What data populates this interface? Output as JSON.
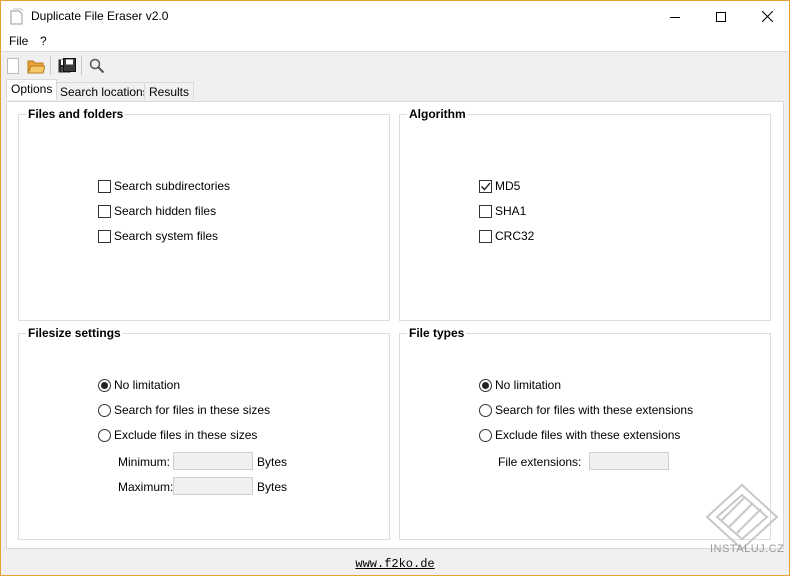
{
  "window": {
    "title": "Duplicate File Eraser v2.0",
    "border_color": "#e8a033"
  },
  "menu": {
    "items": [
      "File",
      "?"
    ]
  },
  "toolbar": {
    "buttons": [
      "new-icon",
      "open-folder-icon",
      "save-icon",
      "search-icon"
    ]
  },
  "tabs": [
    {
      "label": "Options",
      "active": true
    },
    {
      "label": "Search locations",
      "active": false
    },
    {
      "label": "Results",
      "active": false
    }
  ],
  "files_and_folders": {
    "title": "Files and folders",
    "options": [
      {
        "label": "Search subdirectories",
        "checked": false
      },
      {
        "label": "Search hidden files",
        "checked": false
      },
      {
        "label": "Search system files",
        "checked": false
      }
    ]
  },
  "algorithm": {
    "title": "Algorithm",
    "options": [
      {
        "label": "MD5",
        "checked": true
      },
      {
        "label": "SHA1",
        "checked": false
      },
      {
        "label": "CRC32",
        "checked": false
      }
    ]
  },
  "filesize_settings": {
    "title": "Filesize settings",
    "options": [
      {
        "label": "No limitation",
        "selected": true
      },
      {
        "label": "Search for files in these sizes",
        "selected": false
      },
      {
        "label": "Exclude files in these sizes",
        "selected": false
      }
    ],
    "minimum_label": "Minimum:",
    "maximum_label": "Maximum:",
    "unit": "Bytes",
    "minimum_value": "",
    "maximum_value": ""
  },
  "file_types": {
    "title": "File types",
    "options": [
      {
        "label": "No limitation",
        "selected": true
      },
      {
        "label": "Search for files with these extensions",
        "selected": false
      },
      {
        "label": "Exclude files with these extensions",
        "selected": false
      }
    ],
    "extensions_label": "File extensions:",
    "extensions_value": ""
  },
  "status": {
    "link": "www.f2ko.de"
  },
  "watermark": {
    "text": "INSTALUJ.CZ"
  }
}
